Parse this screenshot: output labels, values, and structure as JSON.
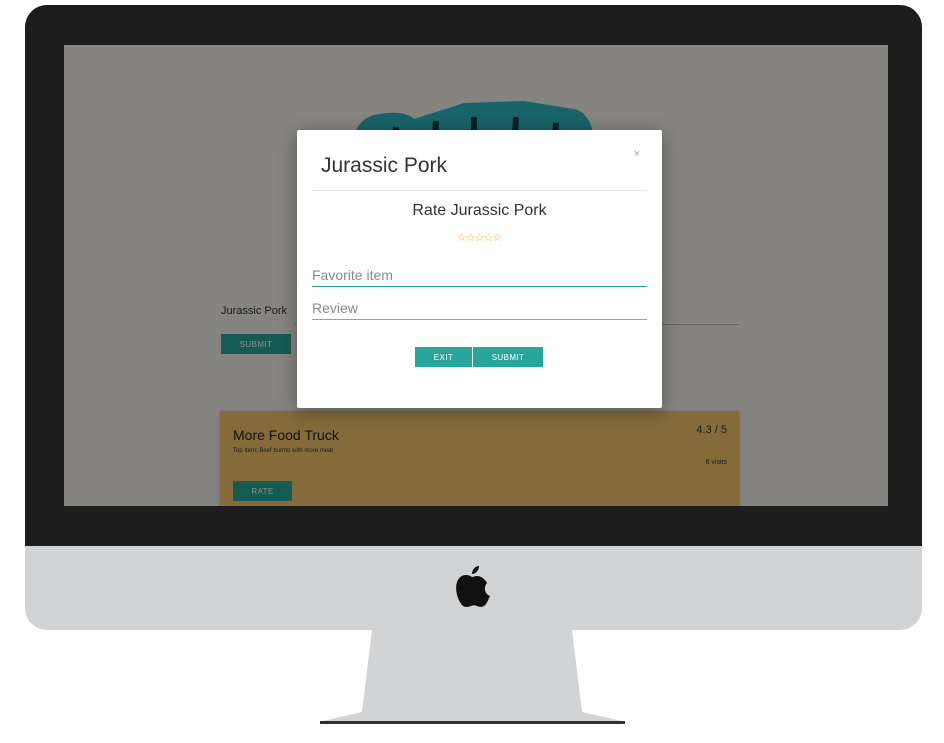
{
  "background_page": {
    "name_label": "Jurassic Pork",
    "submit_label": "SUBMIT",
    "card": {
      "name": "More Food Truck",
      "top_item": "Top Item: Beef burrito with more meat",
      "rating": "4.3 / 5",
      "visits": "6 visits",
      "rate_label": "RATE"
    }
  },
  "modal": {
    "title": "Jurassic Pork",
    "close_glyph": "×",
    "subtitle": "Rate Jurassic Pork",
    "stars": [
      "☆",
      "☆",
      "☆",
      "☆",
      "☆"
    ],
    "star_color": "#f4b400",
    "favorite_placeholder": "Favorite item",
    "review_placeholder": "Review",
    "exit_label": "EXIT",
    "submit_label": "SUBMIT"
  },
  "colors": {
    "accent": "#26a69a",
    "card": "#f3c46a",
    "bezel": "#1d1d1d",
    "chin": "#d2d3d4"
  },
  "icons": {
    "brand": "apple-logo-icon",
    "close": "close-icon",
    "star": "star-outline-icon"
  }
}
